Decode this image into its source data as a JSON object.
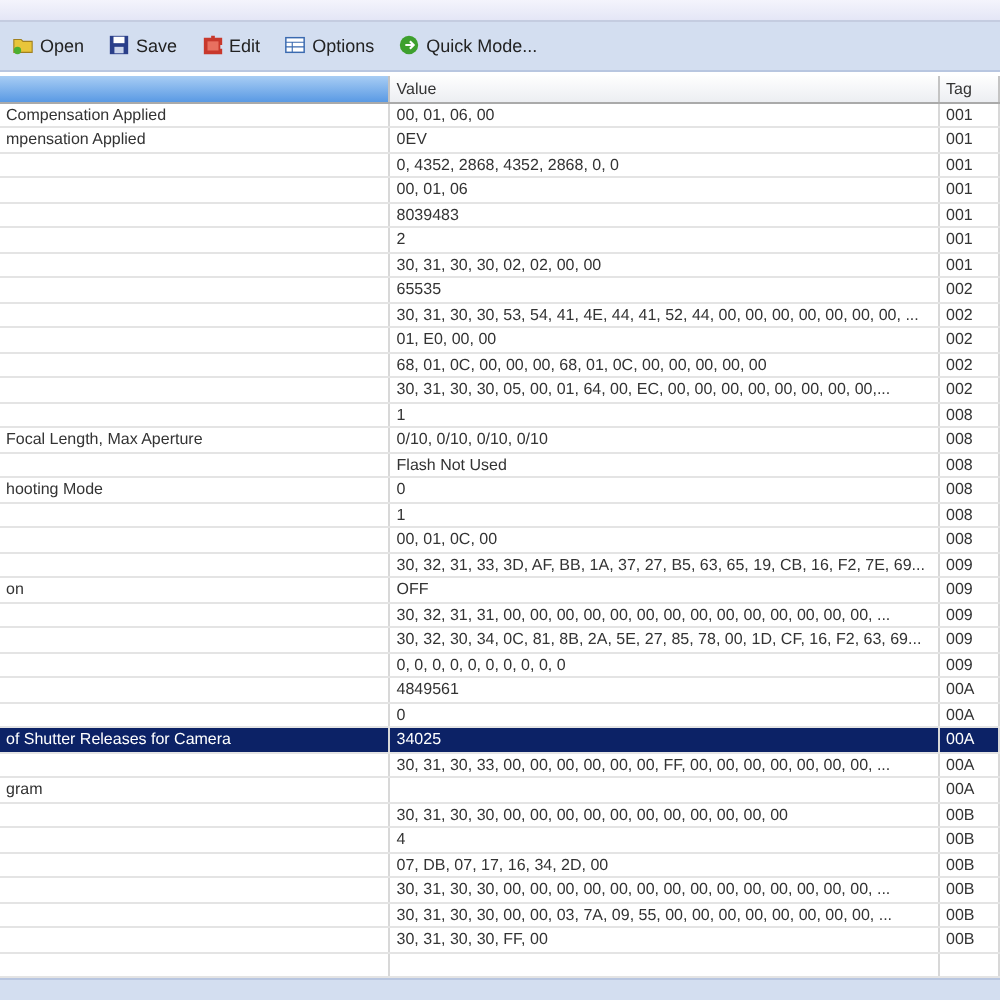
{
  "toolbar": [
    {
      "label": "Open",
      "kind": "open"
    },
    {
      "label": "Save",
      "kind": "save"
    },
    {
      "label": "Edit",
      "kind": "edit"
    },
    {
      "label": "Options",
      "kind": "options"
    },
    {
      "label": "Quick Mode...",
      "kind": "quick"
    }
  ],
  "table": {
    "columns": [
      "Value",
      "Tag"
    ],
    "rows": [
      {
        "name": "Compensation Applied",
        "value": "00, 01, 06, 00",
        "tag": "001",
        "selected": false
      },
      {
        "name": "mpensation Applied",
        "value": "0EV",
        "tag": "001",
        "selected": false
      },
      {
        "name": "",
        "value": "0, 4352, 2868, 4352, 2868, 0, 0",
        "tag": "001",
        "selected": false
      },
      {
        "name": "",
        "value": "00, 01, 06",
        "tag": "001",
        "selected": false
      },
      {
        "name": "",
        "value": "8039483",
        "tag": "001",
        "selected": false
      },
      {
        "name": "",
        "value": "2",
        "tag": "001",
        "selected": false
      },
      {
        "name": "",
        "value": "30, 31, 30, 30, 02, 02, 00, 00",
        "tag": "001",
        "selected": false
      },
      {
        "name": "",
        "value": "65535",
        "tag": "002",
        "selected": false
      },
      {
        "name": "",
        "value": "30, 31, 30, 30, 53, 54, 41, 4E, 44, 41, 52, 44, 00, 00, 00, 00, 00, 00, 00, ...",
        "tag": "002",
        "selected": false
      },
      {
        "name": "",
        "value": "01, E0, 00, 00",
        "tag": "002",
        "selected": false
      },
      {
        "name": "",
        "value": "68, 01, 0C, 00, 00, 00, 68, 01, 0C, 00, 00, 00, 00, 00",
        "tag": "002",
        "selected": false
      },
      {
        "name": "",
        "value": "30, 31, 30, 30, 05, 00, 01, 64, 00, EC, 00, 00, 00, 00, 00, 00, 00, 00,...",
        "tag": "002",
        "selected": false
      },
      {
        "name": "",
        "value": "1",
        "tag": "008",
        "selected": false
      },
      {
        "name": "Focal Length, Max Aperture",
        "value": "0/10, 0/10, 0/10, 0/10",
        "tag": "008",
        "selected": false
      },
      {
        "name": "",
        "value": "Flash Not Used",
        "tag": "008",
        "selected": false
      },
      {
        "name": "hooting Mode",
        "value": "0",
        "tag": "008",
        "selected": false
      },
      {
        "name": "",
        "value": "1",
        "tag": "008",
        "selected": false
      },
      {
        "name": "",
        "value": "00, 01, 0C, 00",
        "tag": "008",
        "selected": false
      },
      {
        "name": "",
        "value": "30, 32, 31, 33, 3D, AF, BB, 1A, 37, 27, B5, 63, 65, 19, CB, 16, F2, 7E, 69...",
        "tag": "009",
        "selected": false
      },
      {
        "name": "on",
        "value": "OFF",
        "tag": "009",
        "selected": false
      },
      {
        "name": "",
        "value": "30, 32, 31, 31, 00, 00, 00, 00, 00, 00, 00, 00, 00, 00, 00, 00, 00, 00, ...",
        "tag": "009",
        "selected": false
      },
      {
        "name": "",
        "value": "30, 32, 30, 34, 0C, 81, 8B, 2A, 5E, 27, 85, 78, 00, 1D, CF, 16, F2, 63, 69...",
        "tag": "009",
        "selected": false
      },
      {
        "name": "",
        "value": "0, 0, 0, 0, 0, 0, 0, 0, 0, 0",
        "tag": "009",
        "selected": false
      },
      {
        "name": "",
        "value": "4849561",
        "tag": "00A",
        "selected": false
      },
      {
        "name": "",
        "value": "0",
        "tag": "00A",
        "selected": false
      },
      {
        "name": "of Shutter Releases for Camera",
        "value": "34025",
        "tag": "00A",
        "selected": true
      },
      {
        "name": "",
        "value": "30, 31, 30, 33, 00, 00, 00, 00, 00, 00, FF, 00, 00, 00, 00, 00, 00, 00, ...",
        "tag": "00A",
        "selected": false
      },
      {
        "name": "gram",
        "value": "",
        "tag": "00A",
        "selected": false
      },
      {
        "name": "",
        "value": "30, 31, 30, 30, 00, 00, 00, 00, 00, 00, 00, 00, 00, 00, 00",
        "tag": "00B",
        "selected": false
      },
      {
        "name": "",
        "value": "4",
        "tag": "00B",
        "selected": false
      },
      {
        "name": "",
        "value": "07, DB, 07, 17, 16, 34, 2D, 00",
        "tag": "00B",
        "selected": false
      },
      {
        "name": "",
        "value": "30, 31, 30, 30, 00, 00, 00, 00, 00, 00, 00, 00, 00, 00, 00, 00, 00, 00, ...",
        "tag": "00B",
        "selected": false
      },
      {
        "name": "",
        "value": "30, 31, 30, 30, 00, 00, 03, 7A, 09, 55, 00, 00, 00, 00, 00, 00, 00, 00, ...",
        "tag": "00B",
        "selected": false
      },
      {
        "name": "",
        "value": "30, 31, 30, 30, FF, 00",
        "tag": "00B",
        "selected": false
      }
    ]
  }
}
